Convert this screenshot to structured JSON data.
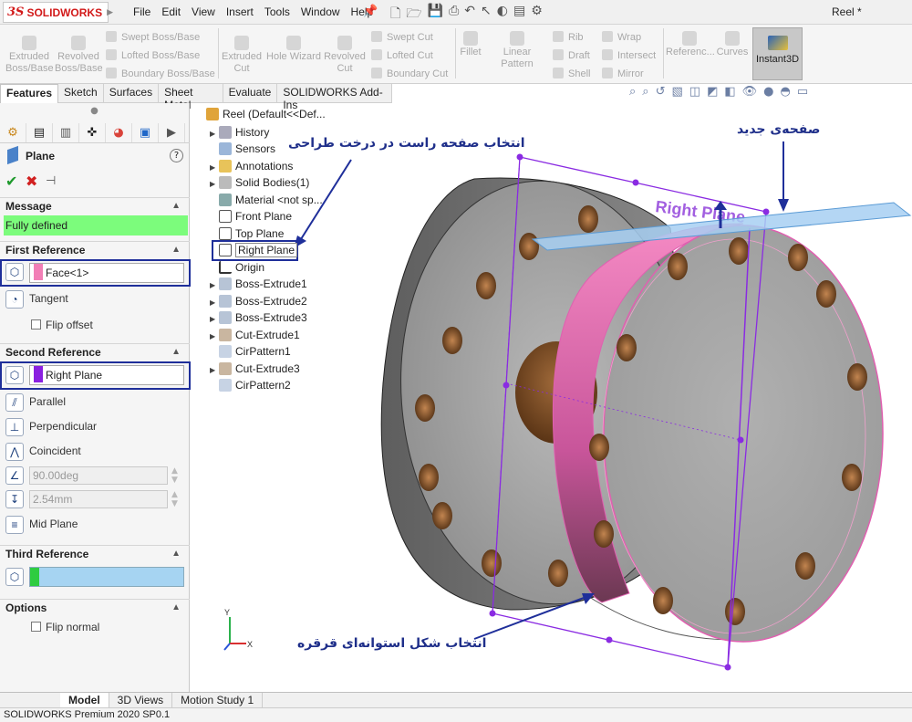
{
  "app": {
    "logo_ds": "3S",
    "logo_text": "SOLIDWORKS",
    "doc_title": "Reel *"
  },
  "menu": [
    "File",
    "Edit",
    "View",
    "Insert",
    "Tools",
    "Window",
    "Help"
  ],
  "commands": {
    "extruded_boss": "Extruded\nBoss/Base",
    "revolved_boss": "Revolved\nBoss/Base",
    "swept_boss": "Swept Boss/Base",
    "lofted_boss": "Lofted Boss/Base",
    "boundary_boss": "Boundary Boss/Base",
    "extruded_cut": "Extruded\nCut",
    "hole_wizard": "Hole Wizard",
    "revolved_cut": "Revolved\nCut",
    "swept_cut": "Swept Cut",
    "lofted_cut": "Lofted Cut",
    "boundary_cut": "Boundary Cut",
    "fillet": "Fillet",
    "linear_pattern": "Linear Pattern",
    "rib": "Rib",
    "draft": "Draft",
    "shell": "Shell",
    "wrap": "Wrap",
    "intersect": "Intersect",
    "mirror": "Mirror",
    "reference": "Referenc...",
    "curves": "Curves",
    "instant3d": "Instant3D"
  },
  "tabs": [
    "Features",
    "Sketch",
    "Surfaces",
    "Sheet Metal",
    "Evaluate",
    "SOLIDWORKS Add-Ins"
  ],
  "panel": {
    "title": "Plane",
    "help": "?",
    "message_header": "Message",
    "message": "Fully defined",
    "first_ref_header": "First Reference",
    "first_ref_value": "Face<1>",
    "first_ref_option": "Tangent",
    "flip_offset": "Flip offset",
    "second_ref_header": "Second Reference",
    "second_ref_value": "Right Plane",
    "options_second": [
      "Parallel",
      "Perpendicular",
      "Coincident"
    ],
    "angle_value": "90.00deg",
    "distance_value": "2.54mm",
    "mid_plane": "Mid Plane",
    "third_ref_header": "Third Reference",
    "options_header": "Options",
    "flip_normal": "Flip normal"
  },
  "tree": {
    "root": "Reel  (Default<<Def...",
    "items": [
      "History",
      "Sensors",
      "Annotations",
      "Solid Bodies(1)",
      "Material <not sp...",
      "Front Plane",
      "Top Plane",
      "Right Plane",
      "Origin",
      "Boss-Extrude1",
      "Boss-Extrude2",
      "Boss-Extrude3",
      "Cut-Extrude1",
      "CirPattern1",
      "Cut-Extrude3",
      "CirPattern2"
    ]
  },
  "viewport": {
    "plane_label": "Right Plane",
    "annotation_tree": "انتخاب صفحه راست در درخت طراحی",
    "annotation_new_plane": "صفحه‌ی جدید",
    "annotation_cylinder": "انتخاب شکل استوانه‌ای قرقره",
    "axis_x": "X",
    "axis_y": "Y"
  },
  "bottom_tabs": [
    "Model",
    "3D Views",
    "Motion Study 1"
  ],
  "status": "SOLIDWORKS Premium 2020 SP0.1",
  "colors": {
    "accent": "#1f2f9a",
    "fully_defined": "#7cfc7c",
    "face_swatch": "#f27fb6",
    "plane_swatch": "#8a20e0",
    "third_swatch": "#2ecc40",
    "plane_purple": "#8a2be2"
  }
}
